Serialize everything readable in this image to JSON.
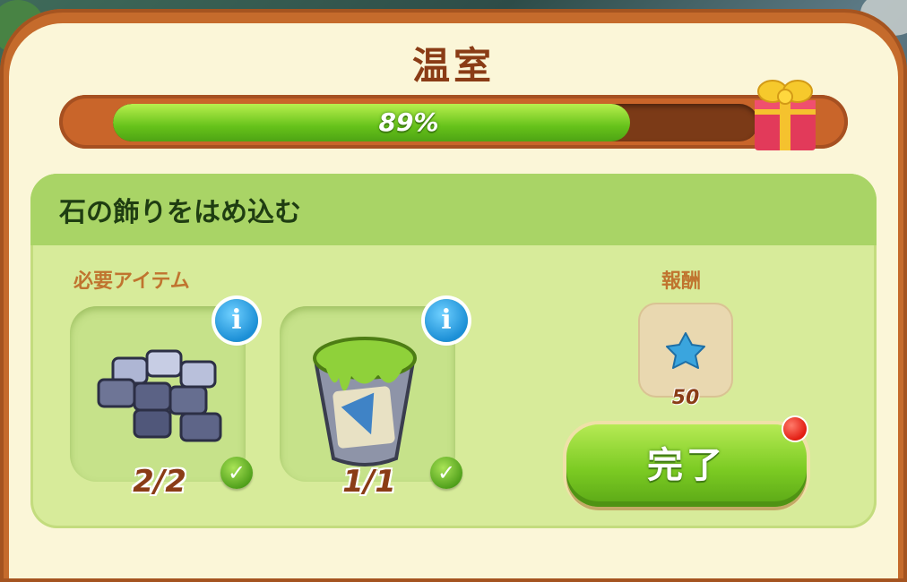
{
  "window": {
    "title": "温室"
  },
  "progress": {
    "percent": 89,
    "label": "89%"
  },
  "task": {
    "title": "石の飾りをはめ込む"
  },
  "requirements": {
    "label": "必要アイテム",
    "items": [
      {
        "name": "stone-tiles",
        "count": "2/2",
        "complete": true
      },
      {
        "name": "green-paint-bucket",
        "count": "1/1",
        "complete": true
      }
    ]
  },
  "reward": {
    "label": "報酬",
    "icon": "blue-star-icon",
    "amount": "50"
  },
  "buttons": {
    "info": "i",
    "check": "✓",
    "complete": "完了"
  },
  "colors": {
    "accent_green": "#7ccb23",
    "frame_orange": "#c56b2c",
    "title_brown": "#8a3c16"
  }
}
